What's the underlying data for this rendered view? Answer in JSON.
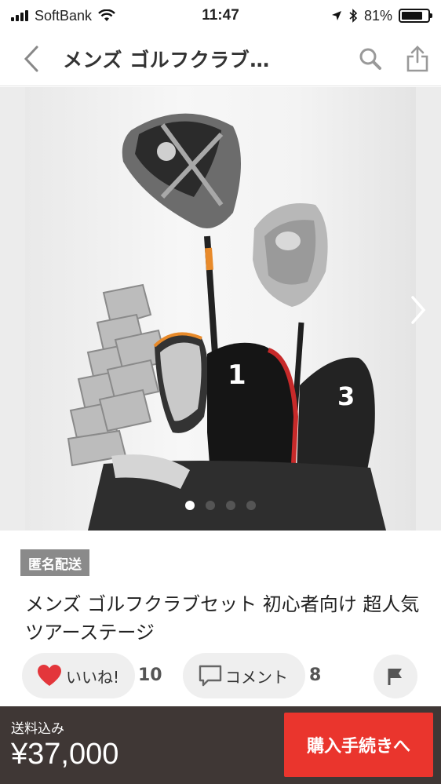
{
  "status_bar": {
    "carrier": "SoftBank",
    "time": "11:47",
    "battery_percent": "81%",
    "battery_level": 0.81,
    "icons": [
      "signal-icon",
      "wifi-icon",
      "location-icon",
      "bluetooth-icon",
      "battery-icon"
    ]
  },
  "header": {
    "title": "メンズ ゴルフクラブ…",
    "back_icon": "chevron-left-icon",
    "search_icon": "search-icon",
    "share_icon": "share-icon"
  },
  "gallery": {
    "image_count": 4,
    "active_index": 0,
    "club_numbers": [
      "1",
      "3"
    ],
    "next_icon": "chevron-right-icon"
  },
  "item": {
    "badge": "匿名配送",
    "title": "メンズ ゴルフクラブセット 初心者向け 超人気 ツアーステージ"
  },
  "actions": {
    "like_label": "いいね!",
    "like_count": "10",
    "comment_label": "コメント",
    "comment_count": "8",
    "flag_icon": "flag-icon"
  },
  "footer": {
    "shipping_label": "送料込み",
    "price": "¥37,000",
    "buy_label": "購入手続きへ"
  },
  "colors": {
    "buy_button": "#ea352d",
    "footer_bg": "#3f3735",
    "like_heart": "#e3363b",
    "badge_bg": "#8a8a8a"
  }
}
